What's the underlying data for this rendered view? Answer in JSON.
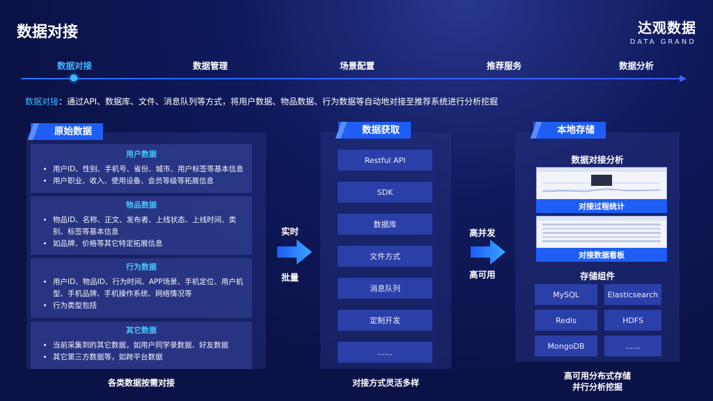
{
  "page": {
    "title": "数据对接"
  },
  "brand": {
    "name_cn": "达观数据",
    "name_en": "DATA GRAND"
  },
  "steps": [
    {
      "label": "数据对接",
      "active": true
    },
    {
      "label": "数据管理",
      "active": false
    },
    {
      "label": "场景配置",
      "active": false
    },
    {
      "label": "推荐服务",
      "active": false
    },
    {
      "label": "数据分析",
      "active": false
    }
  ],
  "description": {
    "highlight": "数据对接",
    "text": "：通过API、数据库、文件、消息队列等方式，将用户数据、物品数据、行为数据等自动地对接至推荐系统进行分析挖掘"
  },
  "raw_data": {
    "header": "原始数据",
    "sections": [
      {
        "title": "用户数据",
        "items": [
          "用户ID、性别、手机号、省份、城市、用户标签等基本信息",
          "用户职业、收入、使用设备、会员等级等拓展信息"
        ]
      },
      {
        "title": "物品数据",
        "items": [
          "物品ID、名称、正文、发布者、上线状态、上线时间、类别、标签等基本信息",
          "如品牌、价格等其它特定拓展信息"
        ]
      },
      {
        "title": "行为数据",
        "items": [
          "用户ID、物品ID、行为时间、APP场景、手机定位、用户机型、手机品牌、手机操作系统、网络情况等",
          "行为类型包括"
        ]
      },
      {
        "title": "其它数据",
        "items": [
          "当前采集到的其它数据，如用户同学录数据、好友数据",
          "其它第三方数据等，如跨平台数据"
        ]
      }
    ],
    "caption": "各类数据按需对接"
  },
  "arrow1": {
    "top_label": "实时",
    "bottom_label": "批量"
  },
  "acquisition": {
    "header": "数据获取",
    "items": [
      "Restful API",
      "SDK",
      "数据库",
      "文件方式",
      "消息队列",
      "定制开发",
      "……"
    ],
    "caption": "对接方式灵活多样"
  },
  "arrow2": {
    "top_label": "高并发",
    "bottom_label": "高可用"
  },
  "storage": {
    "header": "本地存储",
    "analysis_title": "数据对接分析",
    "dashboards": [
      "对接过程统计",
      "对接数据看板"
    ],
    "components_title": "存储组件",
    "components": [
      "MySQL",
      "Elasticsearch",
      "Redis",
      "HDFS",
      "MongoDB",
      "……"
    ],
    "caption_line1": "高可用分布式存储",
    "caption_line2": "并行分析挖掘"
  },
  "colors": {
    "accent": "#3fb6ff",
    "brand_blue": "#1e5ef5",
    "bg": "#0a1246"
  }
}
